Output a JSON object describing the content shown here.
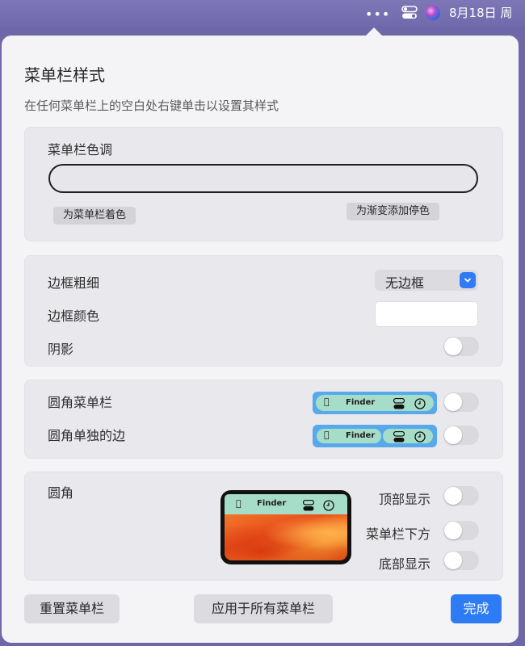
{
  "menubar": {
    "dots_icon": "ellipsis-icon",
    "date_text": "8月18日 周"
  },
  "panel": {
    "title": "菜单栏样式",
    "subtitle": "在任何菜单栏上的空白处右键单击以设置其样式"
  },
  "tint_section": {
    "label": "菜单栏色调",
    "colorize_button": "为菜单栏着色",
    "add_stop_button": "为渐变添加停色"
  },
  "border_section": {
    "width_label": "边框粗细",
    "width_value": "无边框",
    "color_label": "边框颜色",
    "color_value": "#ffffff",
    "shadow_label": "阴影",
    "shadow_on": false
  },
  "rounded_section": {
    "rounded_menubar_label": "圆角菜单栏",
    "rounded_menubar_on": false,
    "rounded_edges_label": "圆角单独的边",
    "rounded_edges_on": false,
    "preview_finder": "Finder"
  },
  "corner_section": {
    "label": "圆角",
    "preview_finder": "Finder",
    "top_label": "顶部显示",
    "top_on": false,
    "below_label": "菜单栏下方",
    "below_on": false,
    "bottom_label": "底部显示",
    "bottom_on": false
  },
  "footer": {
    "reset_button": "重置菜单栏",
    "apply_all_button": "应用于所有菜单栏",
    "done_button": "完成"
  },
  "colors": {
    "accent": "#2d7cf6",
    "menubar_preview_tint": "#a6ddc8",
    "menubar_preview_border": "#57a9ec"
  }
}
